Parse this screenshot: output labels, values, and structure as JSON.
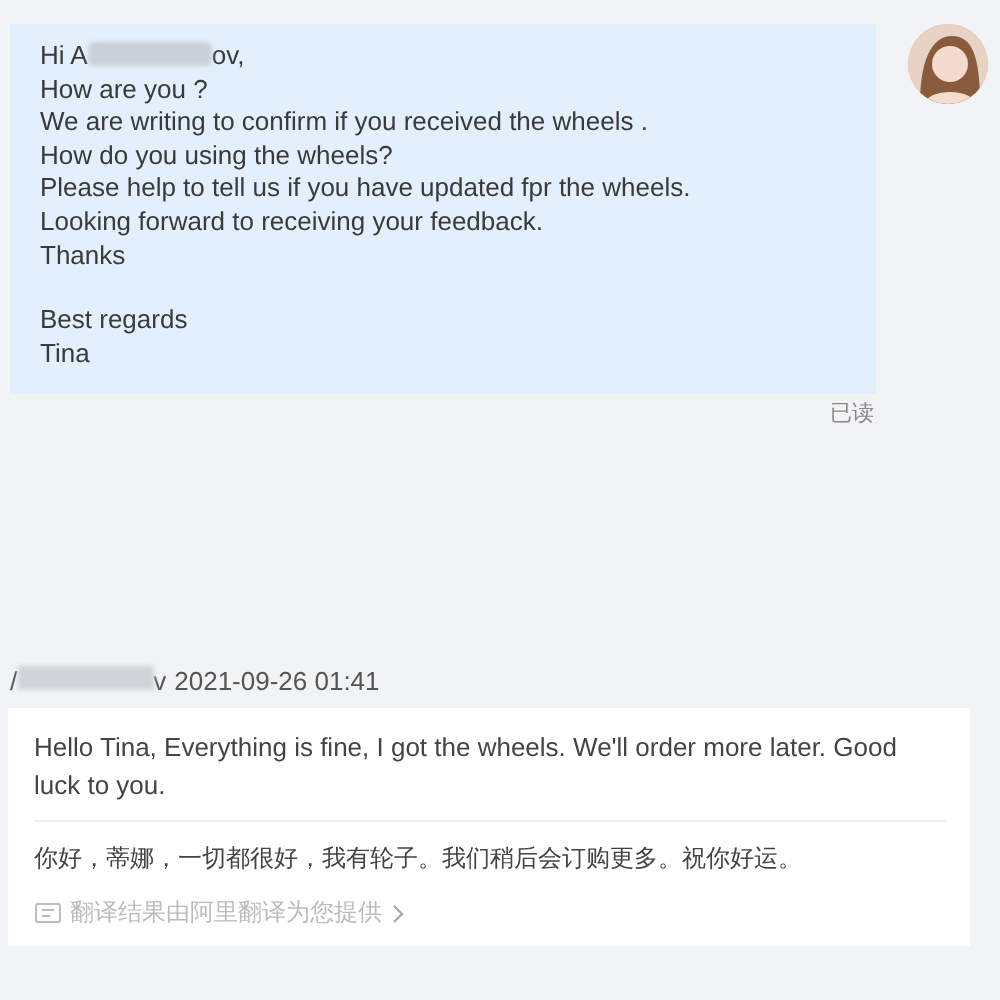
{
  "outgoing": {
    "greeting_start": "Hi A",
    "greeting_end": "ov,",
    "lines": [
      "How are you ?",
      "We are writing to confirm if you received the wheels .",
      "How do you using the wheels?",
      "Please help to tell us if you have updated fpr the wheels.",
      "Looking forward to receiving your feedback.",
      "Thanks"
    ],
    "closing": [
      "Best regards",
      "Tina"
    ],
    "status": "已读"
  },
  "incoming": {
    "sender_start": "/",
    "sender_end": "v",
    "time": "2021-09-26 01:41",
    "text": "Hello Tina, Everything is fine, I got the wheels. We'll order more later. Good luck to you.",
    "translation": "你好，蒂娜，一切都很好，我有轮子。我们稍后会订购更多。祝你好运。",
    "translation_note": "翻译结果由阿里翻译为您提供"
  }
}
